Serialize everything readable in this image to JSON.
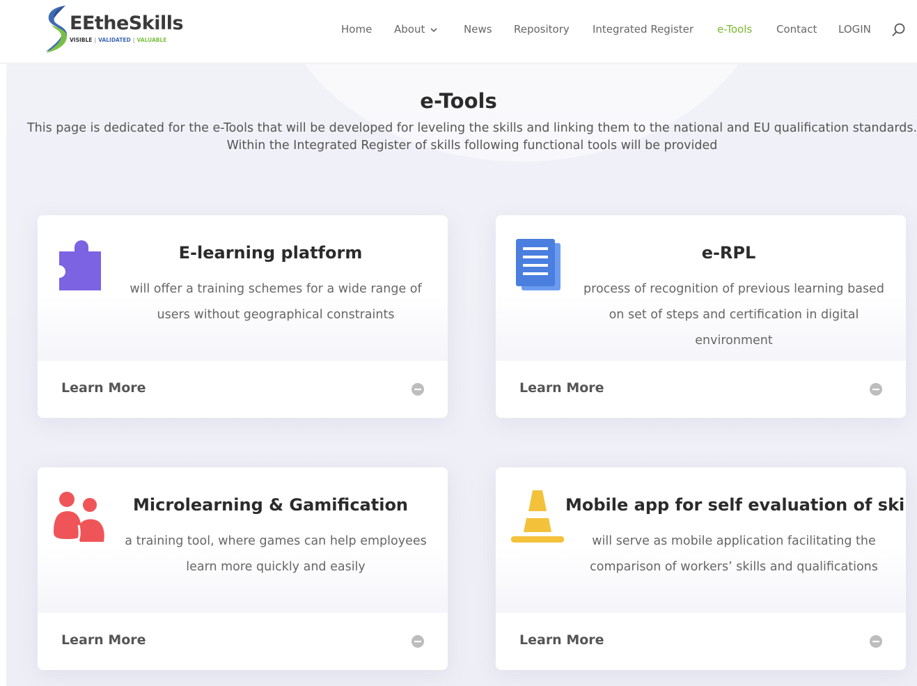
{
  "brand": {
    "name": "EEtheSkills",
    "tagline_1": "VISIBLE",
    "tagline_2": "VALIDATED",
    "tagline_3": "VALUABLE",
    "colors": {
      "green": "#7cc242",
      "blue": "#3f6ab5",
      "dark": "#3b3a3a"
    }
  },
  "nav": {
    "items": [
      {
        "label": "Home"
      },
      {
        "label": "About"
      },
      {
        "label": "News"
      },
      {
        "label": "Repository"
      },
      {
        "label": "Integrated Register"
      },
      {
        "label": "e-Tools",
        "active": true
      },
      {
        "label": "Contact"
      },
      {
        "label": "LOGIN"
      }
    ],
    "active_color": "#7cb82f",
    "search_icon": "search-icon"
  },
  "page": {
    "title": "e-Tools",
    "intro_line_1": "This page is dedicated for the e-Tools that will be developed for leveling the skills and linking them to the national and EU qualification standards.",
    "intro_line_2": "Within the Integrated Register of skills following functional tools will be provided"
  },
  "cards": [
    {
      "icon": "puzzle-icon",
      "icon_color": "#7b63e2",
      "title": "E-learning platform",
      "description": "will offer a training schemes for a wide range of users without geographical constraints",
      "link_label": "Learn More"
    },
    {
      "icon": "document-icon",
      "icon_color": "#4a7fe0",
      "title": "e-RPL",
      "description": "process of recognition of previous learning based on set of steps and certification in digital environment",
      "link_label": "Learn More"
    },
    {
      "icon": "people-icon",
      "icon_color": "#ef5558",
      "title": "Microlearning & Gamification",
      "description": "a training tool, where games can help employees learn more quickly and easily",
      "link_label": "Learn More"
    },
    {
      "icon": "cone-icon",
      "icon_color": "#f4c13a",
      "title": "Mobile app for self evaluation of skills",
      "description": "will serve as mobile application facilitating the comparison of workers’ skills and qualifications",
      "link_label": "Learn More"
    }
  ]
}
